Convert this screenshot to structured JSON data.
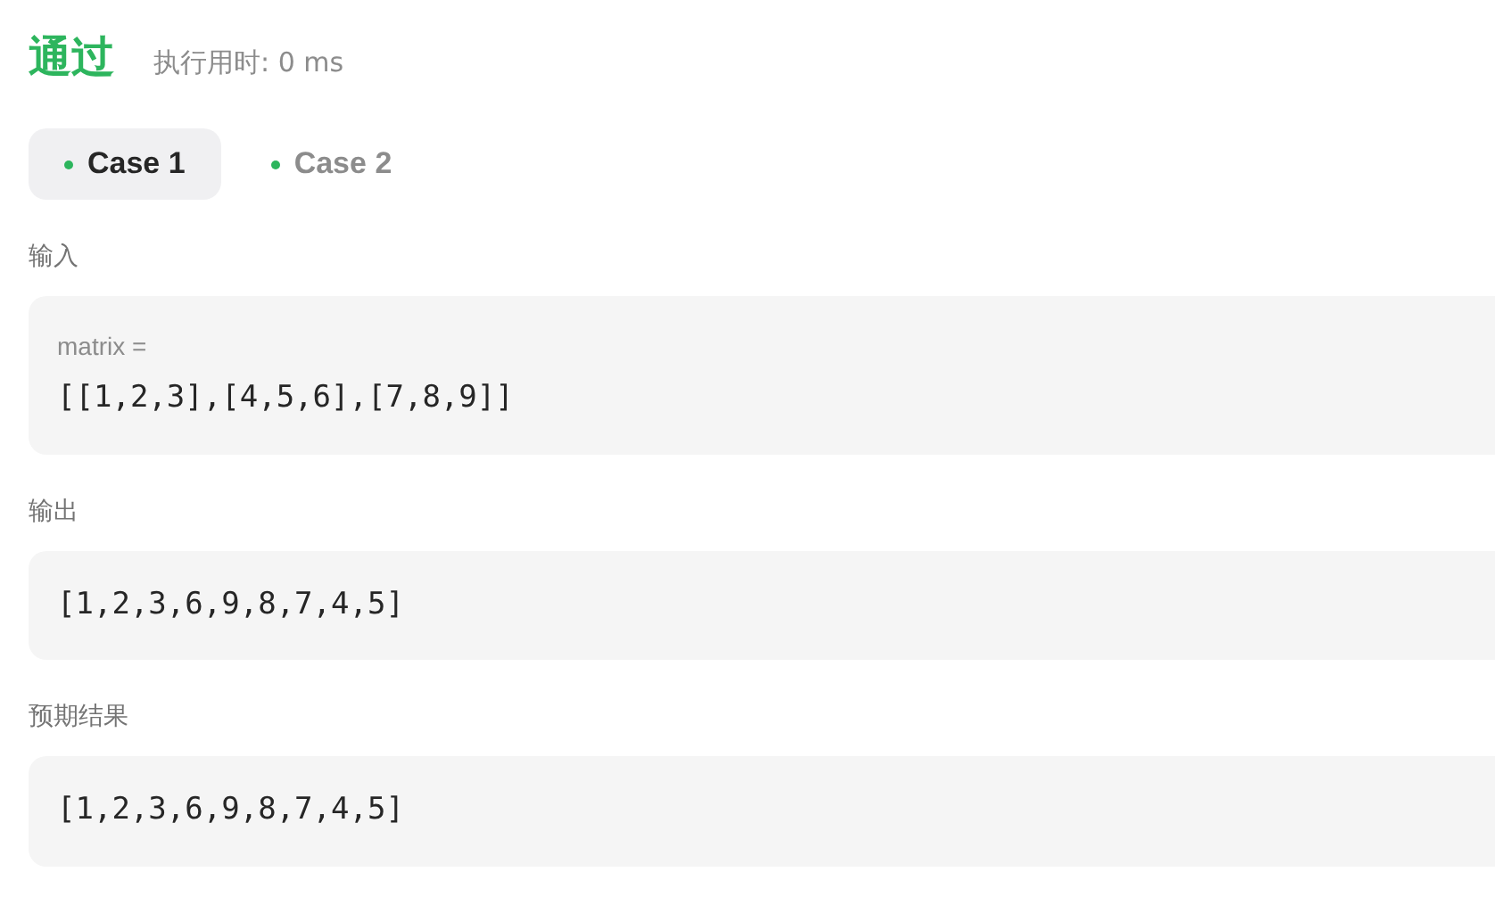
{
  "result": {
    "status": "通过",
    "runtime": "执行用时: 0 ms"
  },
  "cases": [
    {
      "label": "Case 1",
      "selected": true,
      "passed": true
    },
    {
      "label": "Case 2",
      "selected": false,
      "passed": true
    }
  ],
  "sections": [
    {
      "label": "输入",
      "params": [
        {
          "name": "matrix =",
          "value": "[[1,2,3],[4,5,6],[7,8,9]]"
        }
      ]
    },
    {
      "label": "输出",
      "value": "[1,2,3,6,9,8,7,4,5]"
    },
    {
      "label": "预期结果",
      "value": "[1,2,3,6,9,8,7,4,5]"
    }
  ]
}
